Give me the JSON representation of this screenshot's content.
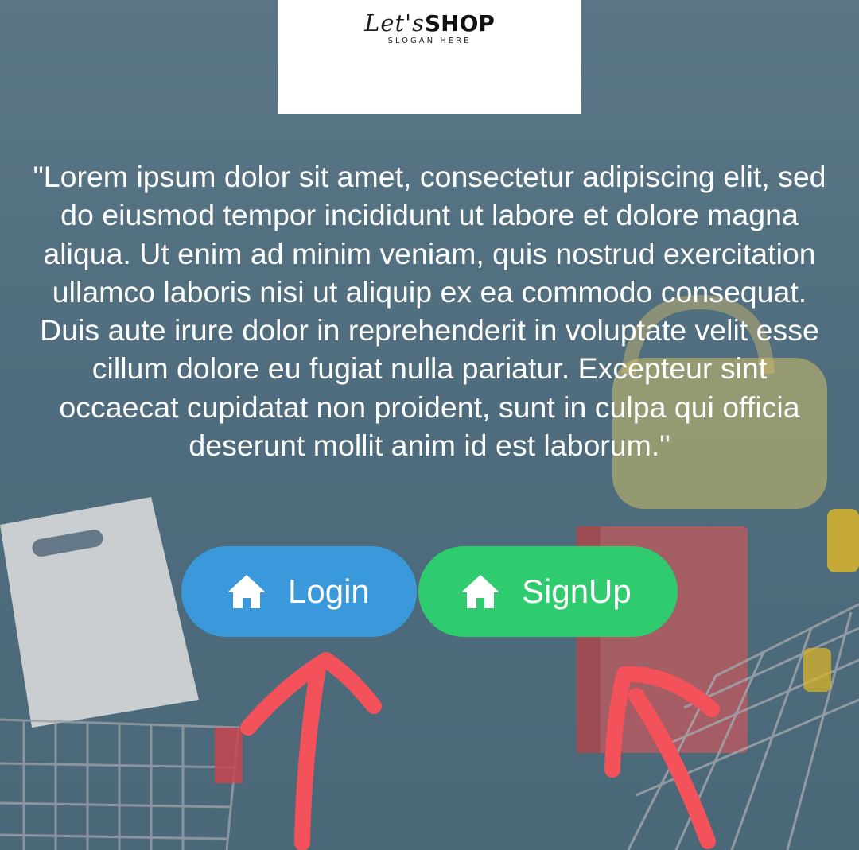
{
  "logo": {
    "brand_prefix": "Let's",
    "brand_name": "SHOP",
    "slogan": "SLOGAN HERE"
  },
  "intro": {
    "text": "\"Lorem ipsum dolor sit amet, consectetur adipiscing elit, sed do eiusmod tempor incididunt ut labore et dolore magna aliqua. Ut enim ad minim veniam, quis nostrud exercitation ullamco laboris nisi ut aliquip ex ea commodo consequat. Duis aute irure dolor in reprehenderit in voluptate velit esse cillum dolore eu fugiat nulla pariatur. Excepteur sint occaecat cupidatat non proident, sunt in culpa qui officia deserunt mollit anim id est laborum.\""
  },
  "buttons": {
    "login": {
      "label": "Login",
      "icon": "home-icon",
      "color": "#3a99db"
    },
    "signup": {
      "label": "SignUp",
      "icon": "home-icon",
      "color": "#2ecc6e"
    }
  },
  "annotation": {
    "arrow_color": "#f4525a"
  },
  "theme": {
    "background": "#4f6d7e",
    "text": "#ffffff",
    "logo_bg": "#ffffff"
  }
}
